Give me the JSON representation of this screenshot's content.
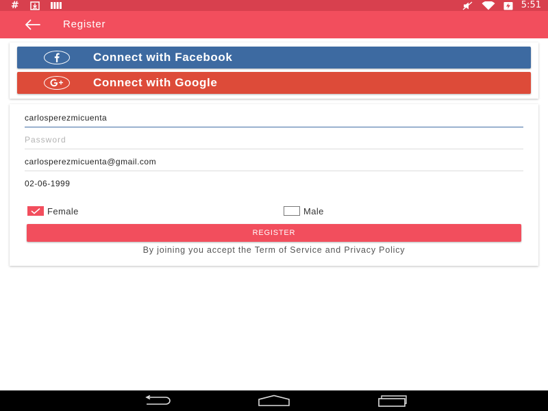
{
  "status_bar": {
    "time": "5:51",
    "hash_symbol": "#",
    "icons": [
      "hash-icon",
      "download-icon",
      "signal-bars-icon",
      "mute-icon",
      "wifi-icon",
      "battery-charging-icon"
    ]
  },
  "toolbar": {
    "title": "Register",
    "back_icon": "arrow-left-icon",
    "color": "#f24e5d"
  },
  "social": {
    "facebook": {
      "label": "Connect with Facebook",
      "icon": "facebook-icon",
      "color": "#3d6aa1"
    },
    "google": {
      "label": "Connect with Google",
      "icon": "google-plus-icon",
      "color": "#dd4b39"
    }
  },
  "form": {
    "username": {
      "value": "carlosperezmicuenta",
      "placeholder": ""
    },
    "password": {
      "value": "",
      "placeholder": "Password"
    },
    "email": {
      "value": "carlosperezmicuenta@gmail.com",
      "placeholder": ""
    },
    "dob": {
      "value": "02-06-1999",
      "placeholder": ""
    },
    "gender": {
      "female_label": "Female",
      "male_label": "Male",
      "selected": "Female"
    },
    "register_label": "REGISTER",
    "terms_text": "By joining you accept the Term of Service and Privacy Policy"
  },
  "nav_bar": {
    "icons": [
      "back-nav-icon",
      "home-nav-icon",
      "recent-apps-icon"
    ]
  }
}
